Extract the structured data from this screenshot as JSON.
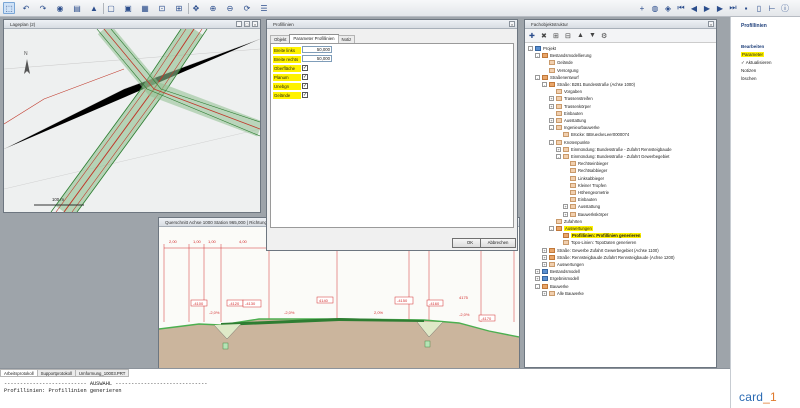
{
  "toolbar": {
    "left_icons": [
      "select-icon",
      "undo-icon",
      "redo-icon",
      "view-icon",
      "layers-icon",
      "terrain-icon",
      "open-icon",
      "save-icon",
      "grid-icon",
      "zoom-window-icon",
      "zoom-all-icon",
      "pan-icon",
      "zoom-in-icon",
      "zoom-out-icon",
      "refresh-icon",
      "properties-icon"
    ],
    "right_icons": [
      "add-icon",
      "globe-icon",
      "layer-stack-icon",
      "first-icon",
      "previous-icon",
      "play-icon",
      "next-icon",
      "last-icon",
      "lock-icon",
      "document-icon",
      "measure-icon",
      "info-icon"
    ]
  },
  "map_window": {
    "title": "Lageplan (2)",
    "scale_label": "100 m",
    "north_label": "N"
  },
  "cross_section_window": {
    "title": "Querschnitt Achse 1000 Station 965,000 | Richtung",
    "widths": [
      "2,00",
      "1,00",
      "1,00",
      "4,00",
      "4,00",
      "1,40",
      "3,00",
      "2,00"
    ],
    "slopes": [
      "-2,0%",
      "-2,0%",
      "2,0%",
      "-2,0%"
    ],
    "labels": [
      "-4100",
      "-4120",
      "-4130",
      "4140",
      "-4150",
      "-4160",
      "-4170",
      "4175"
    ]
  },
  "dialog": {
    "title": "Profillinien",
    "tabs": [
      "Objekt",
      "Parameter Profillinien",
      "Notiz"
    ],
    "selected_tab": "Parameter Profillinien",
    "params": [
      {
        "label": "Breite links",
        "value": "50,000",
        "type": "input"
      },
      {
        "label": "Breite rechts",
        "value": "50,000",
        "type": "input"
      },
      {
        "label": "Oberfläche",
        "value": "✓",
        "type": "check"
      },
      {
        "label": "Planum",
        "value": "✓",
        "type": "check"
      },
      {
        "label": "Unebgn",
        "value": "✓",
        "type": "check"
      },
      {
        "label": "Gelände",
        "value": "✓",
        "type": "check"
      }
    ],
    "ok_label": "OK",
    "cancel_label": "Abbrechen"
  },
  "tree_window": {
    "title": "Fachobjektstruktur",
    "nodes": [
      {
        "label": "Projekt",
        "icon": "blue",
        "exp": "-"
      },
      {
        "label": "Bestandsmodellierung",
        "icon": "orange",
        "exp": "-"
      },
      {
        "label": "Gelände",
        "icon": "pale",
        "exp": ""
      },
      {
        "label": "Versorgung",
        "icon": "pale",
        "exp": ""
      },
      {
        "label": "Straßenentwurf",
        "icon": "orange",
        "exp": "-"
      },
      {
        "label": "Straße: B281 Bundesstraße (Achse 1000)",
        "icon": "orange",
        "exp": "-"
      },
      {
        "label": "Vorgaben",
        "icon": "pale",
        "exp": ""
      },
      {
        "label": "Trassenstreifen",
        "icon": "pale",
        "exp": "+"
      },
      {
        "label": "Trassenkörper",
        "icon": "pale",
        "exp": "+"
      },
      {
        "label": "Einbauten",
        "icon": "pale",
        "exp": ""
      },
      {
        "label": "Ausstattung",
        "icon": "pale",
        "exp": "+"
      },
      {
        "label": "Ingenieurbauwerke",
        "icon": "pale",
        "exp": "-"
      },
      {
        "label": "Brücke: BBrueckeLeer0000074",
        "icon": "pale",
        "exp": ""
      },
      {
        "label": "Knotenpunkte",
        "icon": "pale",
        "exp": "-"
      },
      {
        "label": "Einmündung: Bundesstraße - Zufahrt Rennsteigbaude",
        "icon": "pale",
        "exp": "+"
      },
      {
        "label": "Einmündung: Bundesstraße - Zufahrt Gewerbegebiet",
        "icon": "pale",
        "exp": "-"
      },
      {
        "label": "Rechtseinbieger",
        "icon": "pale",
        "exp": ""
      },
      {
        "label": "Rechtsabbieger",
        "icon": "pale",
        "exp": ""
      },
      {
        "label": "Linksabbieger",
        "icon": "pale",
        "exp": ""
      },
      {
        "label": "Kleiner Tropfen",
        "icon": "pale",
        "exp": ""
      },
      {
        "label": "Höhengeometrie",
        "icon": "pale",
        "exp": ""
      },
      {
        "label": "Einbauten",
        "icon": "pale",
        "exp": ""
      },
      {
        "label": "Ausstattung",
        "icon": "pale",
        "exp": "+"
      },
      {
        "label": "Bauwerkskörper",
        "icon": "pale",
        "exp": "+"
      },
      {
        "label": "Zufahrten",
        "icon": "pale",
        "exp": ""
      },
      {
        "label": "Auswertungen",
        "icon": "orange",
        "exp": "-",
        "hl": "hl"
      },
      {
        "label": "Profillinien: Profillinien generieren",
        "icon": "orange",
        "exp": "",
        "hl": "hl2"
      },
      {
        "label": "Topo-Linien: TopoDaten generieren",
        "icon": "pale",
        "exp": ""
      },
      {
        "label": "Straße: Gewerbe Zufahrt Gewerbegebiet (Achse 1100)",
        "icon": "orange",
        "exp": "+"
      },
      {
        "label": "Straße: Rennsteigbaude Zufahrt Rennsteigbaude (Achse 1200)",
        "icon": "orange",
        "exp": "+"
      },
      {
        "label": "Auswertungen",
        "icon": "pale",
        "exp": "+"
      },
      {
        "label": "Bestandsmodell",
        "icon": "blue",
        "exp": "+"
      },
      {
        "label": "Ergebnismodell",
        "icon": "blue",
        "exp": "+"
      },
      {
        "label": "Bauwerke",
        "icon": "orange",
        "exp": "-"
      },
      {
        "label": "Alle Bauwerke",
        "icon": "pale",
        "exp": "+"
      }
    ]
  },
  "right_panel": {
    "heading": "Profillinien",
    "items": [
      {
        "label": "Bearbeiten",
        "style": "bold"
      },
      {
        "label": "Parameter",
        "style": "hl"
      },
      {
        "label": "Aktualisieren",
        "style": "check"
      },
      {
        "label": "Notizen",
        "style": "plain"
      },
      {
        "label": "löschen",
        "style": "plain"
      }
    ],
    "logo_main": "card",
    "logo_accent": "_1"
  },
  "protocol": {
    "tabs": [
      "Arbeitsprotokoll",
      "Supportprotokoll",
      "Umformung_10003.PRT"
    ],
    "lines": [
      "-------------------------- AUSWAHL -----------------------------",
      "Profillinien: Profillinien generieren"
    ]
  }
}
